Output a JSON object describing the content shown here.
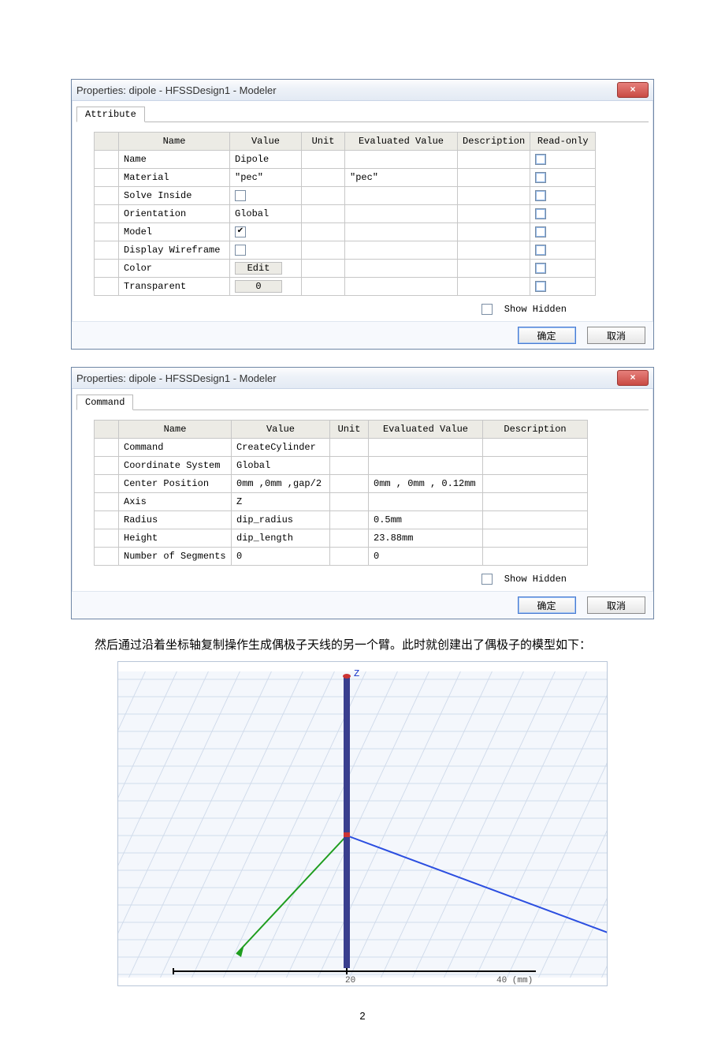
{
  "dialog1": {
    "title": "Properties: dipole - HFSSDesign1 - Modeler",
    "tab": "Attribute",
    "headers": [
      "Name",
      "Value",
      "Unit",
      "Evaluated Value",
      "Description",
      "Read-only"
    ],
    "rows": [
      {
        "name": "Name",
        "value": "Dipole",
        "unit": "",
        "eval": "",
        "desc": "",
        "checkbox": true,
        "checked": false
      },
      {
        "name": "Material",
        "value": "\"pec\"",
        "unit": "",
        "eval": "\"pec\"",
        "desc": "",
        "checkbox": true,
        "checked": false
      },
      {
        "name": "Solve Inside",
        "valueCheckbox": true,
        "valueChecked": false,
        "unit": "",
        "eval": "",
        "desc": "",
        "checkbox": true,
        "checked": false
      },
      {
        "name": "Orientation",
        "value": "Global",
        "unit": "",
        "eval": "",
        "desc": "",
        "checkbox": true,
        "checked": false
      },
      {
        "name": "Model",
        "valueCheckbox": true,
        "valueChecked": true,
        "unit": "",
        "eval": "",
        "desc": "",
        "checkbox": true,
        "checked": false
      },
      {
        "name": "Display Wireframe",
        "valueCheckbox": true,
        "valueChecked": false,
        "unit": "",
        "eval": "",
        "desc": "",
        "checkbox": true,
        "checked": false
      },
      {
        "name": "Color",
        "valueButton": "Edit",
        "unit": "",
        "eval": "",
        "desc": "",
        "checkbox": true,
        "checked": false
      },
      {
        "name": "Transparent",
        "valueButton": "0",
        "unit": "",
        "eval": "",
        "desc": "",
        "checkbox": true,
        "checked": false
      }
    ],
    "showHidden": "Show Hidden",
    "ok": "确定",
    "cancel": "取消"
  },
  "dialog2": {
    "title": "Properties: dipole - HFSSDesign1 - Modeler",
    "tab": "Command",
    "headers": [
      "Name",
      "Value",
      "Unit",
      "Evaluated Value",
      "Description"
    ],
    "rows": [
      {
        "name": "Command",
        "value": "CreateCylinder",
        "unit": "",
        "eval": "",
        "desc": ""
      },
      {
        "name": "Coordinate System",
        "value": "Global",
        "unit": "",
        "eval": "",
        "desc": ""
      },
      {
        "name": "Center Position",
        "value": "0mm ,0mm ,gap/2",
        "unit": "",
        "eval": "0mm , 0mm , 0.12mm",
        "desc": ""
      },
      {
        "name": "Axis",
        "value": "Z",
        "unit": "",
        "eval": "",
        "desc": ""
      },
      {
        "name": "Radius",
        "value": "dip_radius",
        "unit": "",
        "eval": "0.5mm",
        "desc": ""
      },
      {
        "name": "Height",
        "value": "dip_length",
        "unit": "",
        "eval": "23.88mm",
        "desc": ""
      },
      {
        "name": "Number of Segments",
        "value": "0",
        "unit": "",
        "eval": "0",
        "desc": ""
      }
    ],
    "showHidden": "Show Hidden",
    "ok": "确定",
    "cancel": "取消"
  },
  "bodyParagraph": "然后通过沿着坐标轴复制操作生成偶极子天线的另一个臂。此时就创建出了偶极子的模型如下：",
  "viewport": {
    "zLabel": "Z",
    "scaleMid": "20",
    "scaleUnit": "40 (mm)"
  },
  "pageNumber": "2"
}
